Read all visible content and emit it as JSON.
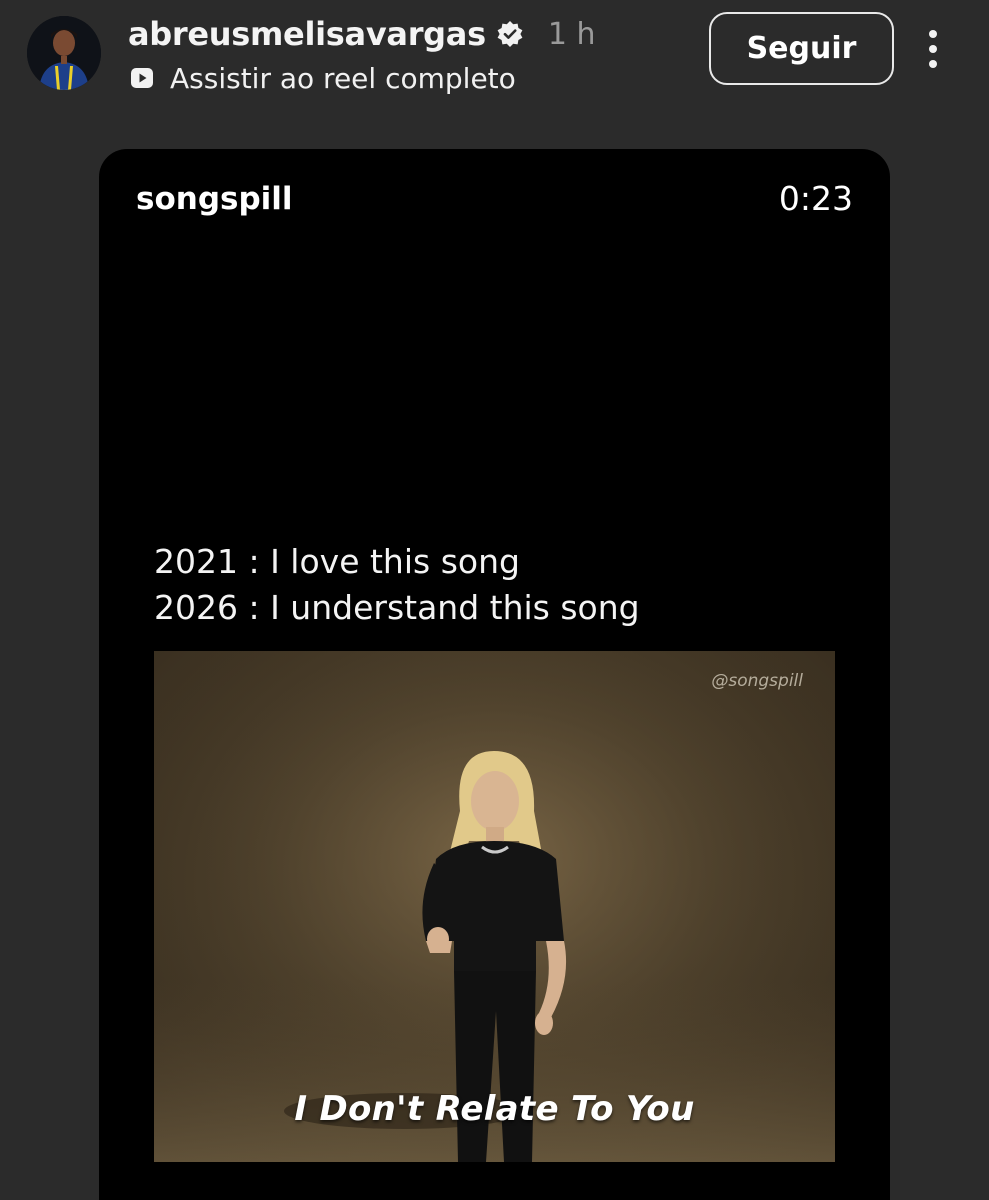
{
  "header": {
    "username": "abreusmelisavargas",
    "verified_icon": "verified-badge-icon",
    "time_ago": "1 h",
    "reel_link_label": "Assistir ao reel completo",
    "reel_link_icon": "play-icon",
    "follow_label": "Seguir",
    "more_icon": "more-vertical-icon"
  },
  "reel": {
    "author": "songspill",
    "duration": "0:23",
    "caption_lines": [
      "2021 : I love this song",
      "2026 : I understand this song"
    ],
    "watermark": "@songspill",
    "subtitle": "I Don't Relate To You"
  },
  "colors": {
    "background": "#2b2b2b",
    "card": "#000000",
    "video_tone": "#5a4b33"
  }
}
